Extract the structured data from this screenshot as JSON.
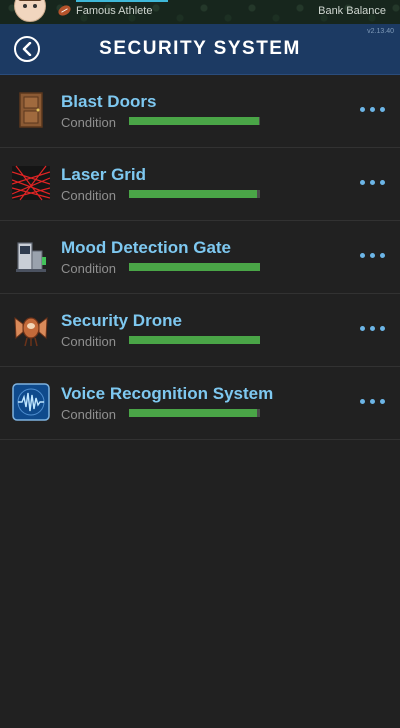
{
  "topbar": {
    "athlete_label": "Famous Athlete",
    "bank_label": "Bank Balance",
    "icons": [
      "avatar",
      "football-icon"
    ]
  },
  "header": {
    "title": "SECURITY SYSTEM",
    "version": "v2.13.40",
    "back_icon": "chevron-left-icon"
  },
  "colors": {
    "name_text": "#7ec8f0",
    "condition_fill": "#4aa547",
    "header_bg": "#1c3a63",
    "more_dots": "#6cb5e6"
  },
  "items": [
    {
      "name": "Blast Doors",
      "condition_label": "Condition",
      "condition": 0.99,
      "icon": "door-icon"
    },
    {
      "name": "Laser Grid",
      "condition_label": "Condition",
      "condition": 0.98,
      "icon": "laser-grid-icon"
    },
    {
      "name": "Mood Detection Gate",
      "condition_label": "Condition",
      "condition": 1.0,
      "icon": "gate-scanner-icon"
    },
    {
      "name": "Security Drone",
      "condition_label": "Condition",
      "condition": 1.0,
      "icon": "drone-icon"
    },
    {
      "name": "Voice Recognition System",
      "condition_label": "Condition",
      "condition": 0.98,
      "icon": "voice-wave-icon"
    }
  ]
}
